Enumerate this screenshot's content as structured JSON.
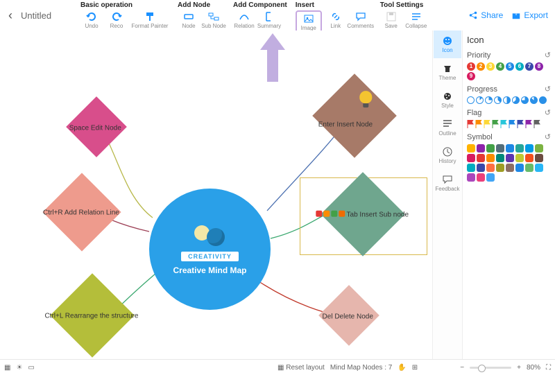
{
  "header": {
    "title": "Untitled",
    "share": "Share",
    "export": "Export",
    "groups": [
      {
        "label": "Basic operation",
        "items": [
          {
            "id": "undo",
            "label": "Undo"
          },
          {
            "id": "redo",
            "label": "Reco"
          },
          {
            "id": "format-painter",
            "label": "Format Painter",
            "wide": true
          }
        ]
      },
      {
        "label": "Add Node",
        "items": [
          {
            "id": "node",
            "label": "Node"
          },
          {
            "id": "sub-node",
            "label": "Sub Node"
          }
        ]
      },
      {
        "label": "Add Component",
        "items": [
          {
            "id": "relation",
            "label": "Relation"
          },
          {
            "id": "summary",
            "label": "Summary"
          }
        ]
      },
      {
        "label": "Insert",
        "items": [
          {
            "id": "image",
            "label": "Image",
            "hl": true
          },
          {
            "id": "link",
            "label": "Link"
          },
          {
            "id": "comments",
            "label": "Comments"
          }
        ]
      },
      {
        "label": "Tool Settings",
        "items": [
          {
            "id": "save",
            "label": "Save",
            "dis": true
          },
          {
            "id": "collapse",
            "label": "Collapse"
          }
        ]
      }
    ]
  },
  "mindmap": {
    "center": {
      "title": "Creative Mind Map",
      "banner": "CREATIVITY"
    },
    "nodes": {
      "n1": "Space Edit Node",
      "n2": "Ctrl+R Add Relation Line",
      "n3": "Ctrl+L Rearrange the structure",
      "n4": "Enter Insert Node",
      "n5": "Tab Insert Sub node",
      "n6": "Del Delete Node"
    }
  },
  "sidebar": {
    "items": [
      {
        "id": "collapse",
        "label": ""
      },
      {
        "id": "theme",
        "label": "Theme"
      },
      {
        "id": "style",
        "label": "Style"
      },
      {
        "id": "icon",
        "label": "Icon",
        "selected": true
      },
      {
        "id": "outline",
        "label": "Outline"
      },
      {
        "id": "history",
        "label": "History"
      },
      {
        "id": "feedback",
        "label": "Feedback"
      }
    ]
  },
  "panel": {
    "title": "Icon",
    "sections": {
      "priority": {
        "label": "Priority",
        "colors": [
          "#e53935",
          "#fb8c00",
          "#fdd835",
          "#43a047",
          "#1e88e5",
          "#00acc1",
          "#3949ab",
          "#8e24aa",
          "#d81b60"
        ]
      },
      "progress": {
        "label": "Progress"
      },
      "flag": {
        "label": "Flag",
        "colors": [
          "#e53935",
          "#fb8c00",
          "#fdd835",
          "#43a047",
          "#26c6da",
          "#1e88e5",
          "#3949ab",
          "#8e24aa",
          "#616161"
        ]
      },
      "symbol": {
        "label": "Symbol",
        "colors": [
          "#ffb300",
          "#8e24aa",
          "#43a047",
          "#546e7a",
          "#1e88e5",
          "#26a69a",
          "#039be5",
          "#7cb342",
          "#d81b60",
          "#e53935",
          "#fb8c00",
          "#00897b",
          "#5e35b1",
          "#c0ca33",
          "#f4511e",
          "#6d4c41",
          "#00acc1",
          "#3949ab",
          "#ff7043",
          "#9e9d24",
          "#8d6e63",
          "#1e88e5",
          "#66bb6a",
          "#29b6f6",
          "#ab47bc",
          "#ec407a",
          "#42a5f5"
        ]
      }
    }
  },
  "status": {
    "reset": "Reset layout",
    "nodes_label": "Mind Map Nodes :",
    "nodes_count": "7",
    "zoom": "80%"
  }
}
